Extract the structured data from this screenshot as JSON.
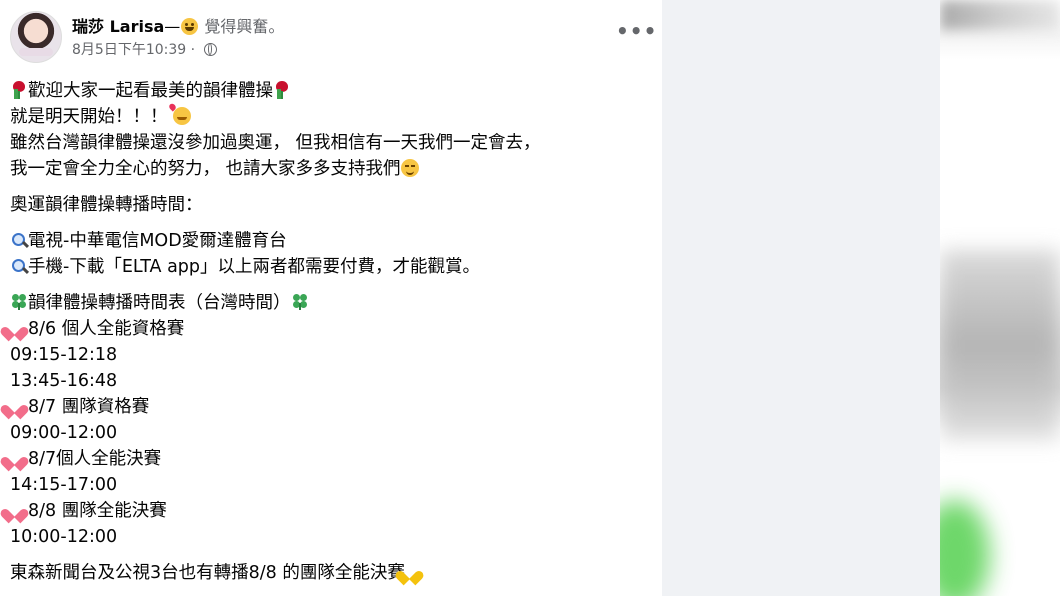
{
  "post": {
    "author_name": "瑞莎 Larisa",
    "feeling_prefix": "—",
    "feeling_text": " 覺得興奮。",
    "timestamp": "8月5日下午10:39",
    "privacy_sep": " · ",
    "more_label": "•••"
  },
  "content": {
    "intro": "歡迎大家一起看最美的韻律體操",
    "tomorrow": "就是明天開始！！！",
    "line3": "雖然台灣韻律體操還沒參加過奧運， 但我相信有一天我們一定會去，",
    "line4": "我一定會全力全心的努力， 也請大家多多支持我們",
    "broadcast_title": "奧運韻律體操轉播時間：",
    "tv": "電視-中華電信MOD愛爾達體育台",
    "mobile": "手機-下載「ELTA app」以上兩者都需要付費，才能觀賞。",
    "schedule_title": "韻律體操轉播時間表（台灣時間）",
    "s1_title": "8/6 個人全能資格賽",
    "s1_t1": "09:15-12:18",
    "s1_t2": "13:45-16:48",
    "s2_title": "8/7 團隊資格賽",
    "s2_t1": "09:00-12:00",
    "s3_title": "8/7個人全能決賽",
    "s3_t1": "14:15-17:00",
    "s4_title": "8/8 團隊全能決賽",
    "s4_t1": "10:00-12:00",
    "footer": "東森新聞台及公視3台也有轉播8/8 的團隊全能決賽"
  },
  "icons": {
    "rose": "rose-icon",
    "heart_face": "smiling-face-with-hearts-icon",
    "smile": "smiling-face-icon",
    "search": "magnifying-glass-icon",
    "clover": "four-leaf-clover-icon",
    "heart": "pink-heart-icon",
    "yellow_heart": "yellow-heart-icon",
    "globe": "globe-icon"
  },
  "colors": {
    "text": "#050505",
    "secondary": "#65676b",
    "panel_bg": "#f0f2f5"
  }
}
